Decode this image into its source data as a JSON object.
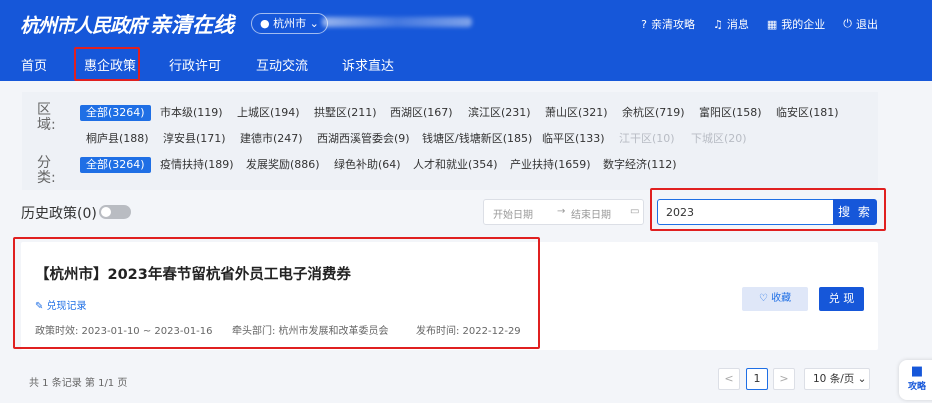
{
  "header": {
    "logo": "杭州市人民政府",
    "logo2": "亲清在线",
    "city": "杭州市",
    "links": [
      "亲清攻略",
      "消息",
      "我的企业",
      "退出"
    ]
  },
  "nav": [
    "首页",
    "惠企政策",
    "行政许可",
    "互动交流",
    "诉求直达"
  ],
  "filters": {
    "region_label": "区域:",
    "regions": [
      "全部(3264)",
      "市本级(119)",
      "上城区(194)",
      "拱墅区(211)",
      "西湖区(167)",
      "滨江区(231)",
      "萧山区(321)",
      "余杭区(719)",
      "富阳区(158)",
      "临安区(181)",
      "桐庐县(188)",
      "淳安县(171)",
      "建德市(247)",
      "西湖西溪管委会(9)",
      "钱塘区/钱塘新区(185)",
      "临平区(133)",
      "江干区(10)",
      "下城区(20)"
    ],
    "category_label": "分类:",
    "categories": [
      "全部(3264)",
      "疫情扶持(189)",
      "发展奖励(886)",
      "绿色补助(64)",
      "人才和就业(354)",
      "产业扶持(1659)",
      "数字经济(112)"
    ]
  },
  "history": {
    "label": "历史政策(0)"
  },
  "date": {
    "start": "开始日期",
    "arrow": "→",
    "end": "结束日期"
  },
  "search": {
    "value": "2023",
    "button": "搜 索"
  },
  "policy": {
    "title": "【杭州市】2023年春节留杭省外员工电子消费券",
    "record": "兑现记录",
    "period": "政策时效:  2023-01-10 ~ 2023-01-16",
    "dept": "牵头部门:  杭州市发展和改革委员会",
    "published": "发布时间:  2022-12-29",
    "fav": "收藏",
    "cash": "兑 现"
  },
  "pagination": {
    "total": "共 1 条记录 第 1/1 页",
    "prev": "<",
    "page": "1",
    "next": ">",
    "per_page": "10 条/页"
  },
  "side": {
    "label": "攻略"
  }
}
